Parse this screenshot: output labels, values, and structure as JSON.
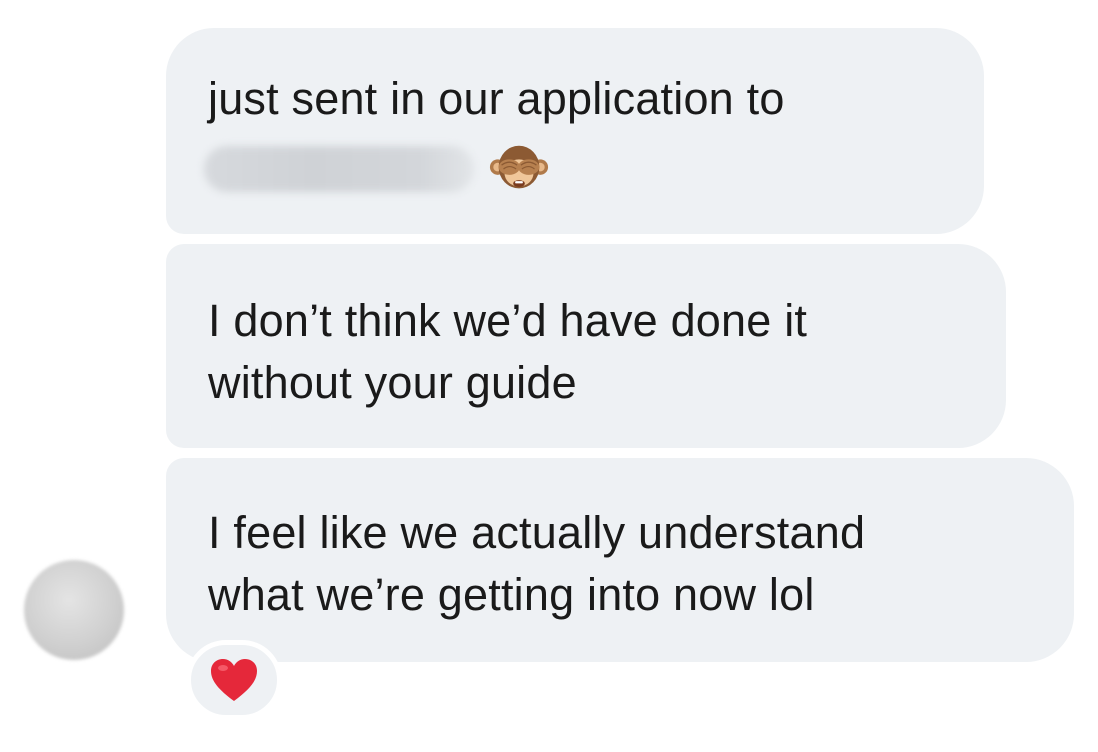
{
  "messages": [
    {
      "lines": [
        "just sent in our application to"
      ],
      "has_redacted_text": true,
      "emoji": "see-no-evil-monkey-icon"
    },
    {
      "lines": [
        "I don’t think we’d have done it",
        "without your guide"
      ]
    },
    {
      "lines": [
        "I feel like we actually understand",
        "what we’re getting into now lol"
      ]
    }
  ],
  "reaction": {
    "icon": "red-heart-icon",
    "color": "#e5283a"
  },
  "colors": {
    "bubble": "#eef1f4",
    "text": "#1a1a1a",
    "background": "#ffffff"
  }
}
